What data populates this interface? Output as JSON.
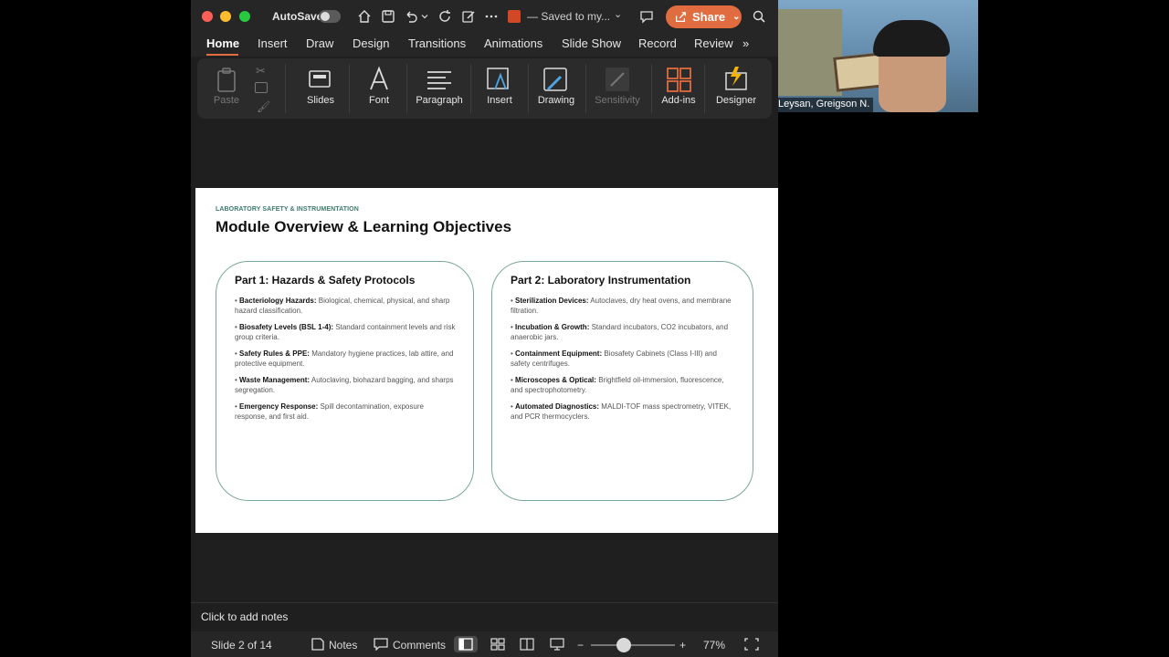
{
  "titlebar": {
    "autosave_label": "AutoSave",
    "saved_status": "— Saved to my...",
    "share_label": "Share"
  },
  "tabs": [
    {
      "label": "Home"
    },
    {
      "label": "Insert"
    },
    {
      "label": "Draw"
    },
    {
      "label": "Design"
    },
    {
      "label": "Transitions"
    },
    {
      "label": "Animations"
    },
    {
      "label": "Slide Show"
    },
    {
      "label": "Record"
    },
    {
      "label": "Review"
    }
  ],
  "ribbon": {
    "paste": "Paste",
    "slides": "Slides",
    "font": "Font",
    "paragraph": "Paragraph",
    "insert": "Insert",
    "drawing": "Drawing",
    "sensitivity": "Sensitivity",
    "addins": "Add-ins",
    "designer": "Designer"
  },
  "slide": {
    "kicker": "LABORATORY SAFETY & INSTRUMENTATION",
    "title": "Module Overview & Learning Objectives",
    "part1": {
      "title": "Part 1: Hazards & Safety Protocols",
      "bullets": [
        {
          "label": "Bacteriology Hazards:",
          "text": "Biological, chemical, physical, and sharp hazard classification."
        },
        {
          "label": "Biosafety Levels (BSL 1-4):",
          "text": "Standard containment levels and risk group criteria."
        },
        {
          "label": "Safety Rules & PPE:",
          "text": "Mandatory hygiene practices, lab attire, and protective equipment."
        },
        {
          "label": "Waste Management:",
          "text": "Autoclaving, biohazard bagging, and sharps segregation."
        },
        {
          "label": "Emergency Response:",
          "text": "Spill decontamination, exposure response, and first aid."
        }
      ]
    },
    "part2": {
      "title": "Part 2: Laboratory Instrumentation",
      "bullets": [
        {
          "label": "Sterilization Devices:",
          "text": "Autoclaves, dry heat ovens, and membrane filtration."
        },
        {
          "label": "Incubation & Growth:",
          "text": "Standard incubators, CO2 incubators, and anaerobic jars."
        },
        {
          "label": "Containment Equipment:",
          "text": "Biosafety Cabinets (Class I-III) and safety centrifuges."
        },
        {
          "label": "Microscopes & Optical:",
          "text": "Brightfield oil-immersion, fluorescence, and spectrophotometry."
        },
        {
          "label": "Automated Diagnostics:",
          "text": "MALDI-TOF mass spectrometry, VITEK, and PCR thermocyclers."
        }
      ]
    }
  },
  "notes": {
    "placeholder": "Click to add notes"
  },
  "statusbar": {
    "slide_indicator": "Slide 2 of 14",
    "notes_label": "Notes",
    "comments_label": "Comments",
    "zoom_minus": "−",
    "zoom_plus": "+",
    "zoom_level": "77%",
    "zoom_fraction": 0.77
  },
  "video": {
    "participant_name": "Leysan, Greigson N."
  },
  "colors": {
    "accent": "#e06c3f",
    "slide_kicker": "#3a7a6a",
    "card_border": "#7aa898"
  }
}
